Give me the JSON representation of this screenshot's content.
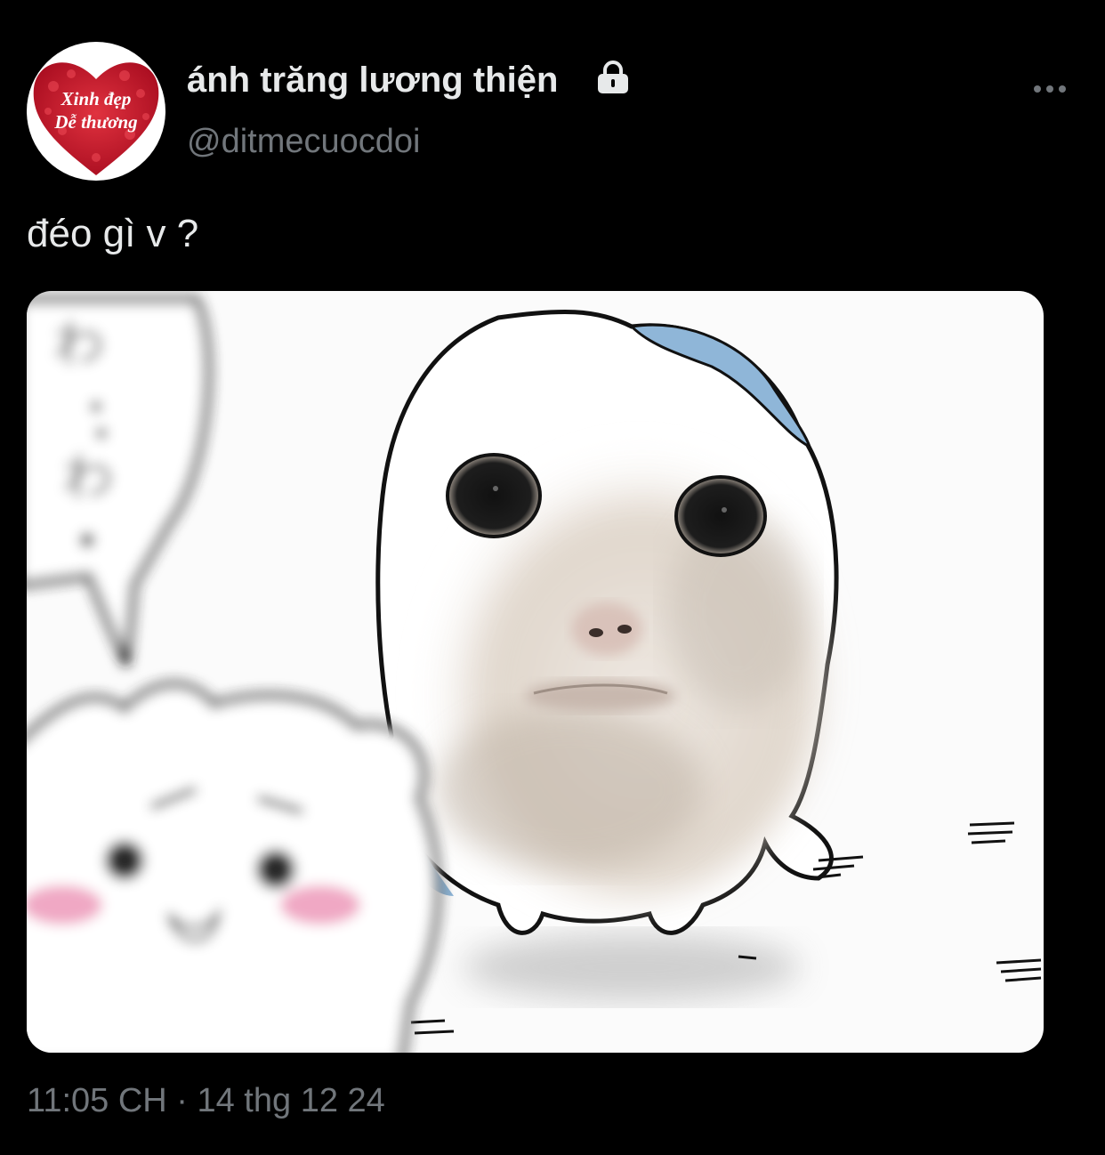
{
  "tweet": {
    "author": {
      "display_name": "ánh trăng lương thiện",
      "handle": "@ditmecuocdoi",
      "protected_icon": "lock-icon",
      "avatar": {
        "line1": "Xinh đẹp",
        "line2": "Dễ thương",
        "heart_color": "#c8102e"
      }
    },
    "more_icon": "more-horizontal-icon",
    "text": "đéo gì v ?",
    "media": {
      "description_icon": "meme-image"
    },
    "timestamp": "11:05 CH · 14 thg 12 24"
  },
  "colors": {
    "background": "#000000",
    "primary_text": "#e7e9ea",
    "secondary_text": "#71767b"
  }
}
